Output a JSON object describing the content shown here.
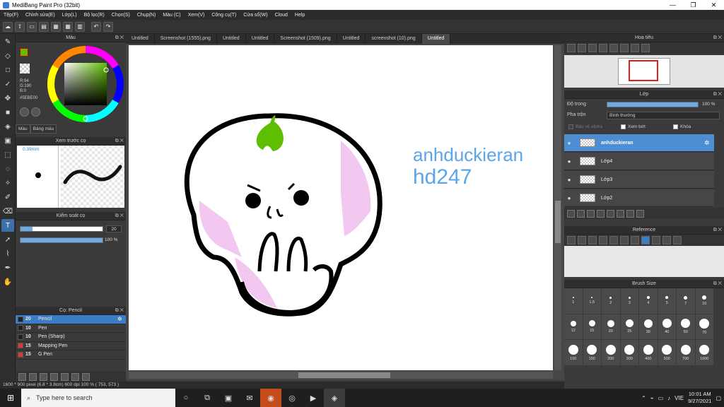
{
  "window": {
    "title": "MediBang Paint Pro (32bit)",
    "controls": [
      "—",
      "❐",
      "✕"
    ]
  },
  "menu": [
    "Tệp(F)",
    "Chỉnh sửa(E)",
    "Lớp(L)",
    "Bộ lọc(R)",
    "Chọn(S)",
    "Chụp(N)",
    "Màu (C)",
    "Xem(V)",
    "Công cụ(T)",
    "Cửa sổ(W)",
    "Cloud",
    "Help"
  ],
  "color_panel": {
    "title": "Màu",
    "r": "R:94",
    "g": "G:190",
    "b": "B:0",
    "hex": "#5EBE00",
    "fg_color": "#5EBE00",
    "tabs": [
      "Màu",
      "Bảng màu"
    ]
  },
  "brush_preview": {
    "title": "Xem trước cọ",
    "size_label": "0.39mm"
  },
  "brush_control": {
    "title": "Kiểm soát cọ",
    "size_value": "20",
    "opacity_value": "100 %",
    "size_fraction": 0.15,
    "opacity_fraction": 1.0
  },
  "brush_list": {
    "title": "Cọ: Pencil",
    "items": [
      {
        "size": "20",
        "name": "Pencil",
        "color": "#222222",
        "active": true
      },
      {
        "size": "10",
        "name": "Pen",
        "color": "#222222"
      },
      {
        "size": "10",
        "name": "Pen (Sharp)",
        "color": "#222222"
      },
      {
        "size": "15",
        "name": "Mapping Pen",
        "color": "#d23b3b"
      },
      {
        "size": "15",
        "name": "G Pen",
        "color": "#d23b3b"
      }
    ]
  },
  "doc_tabs": [
    "Untitled",
    "Screenshot (1555).png",
    "Untitled",
    "Untitled",
    "Screenshot (1509).png",
    "Untitled",
    "screenshot (10).png",
    "Untitled"
  ],
  "active_tab_index": 7,
  "canvas": {
    "text_line1": "anhduckieran",
    "text_line2": "hd247"
  },
  "status": "1600 * 900 pixel  (6.8 * 3.8cm)  600 dpi  100 %  ( 753, 573 )",
  "navigator": {
    "title": "Hoa tiêu"
  },
  "layers": {
    "title": "Lớp",
    "opacity_label": "Độ trong",
    "opacity_value": "100 %",
    "blend_label": "Pha trộn",
    "blend_value": "Bình thường",
    "protect_alpha": "Bảo vệ alpha",
    "clipping": "Xem bớt",
    "lock": "Khóa",
    "items": [
      {
        "name": "anhduckieran",
        "active": true
      },
      {
        "name": "Lớp4"
      },
      {
        "name": "Lớp3"
      },
      {
        "name": "Lớp2"
      }
    ]
  },
  "reference": {
    "title": "Reference"
  },
  "brush_size": {
    "title": "Brush Size",
    "sizes": [
      "1",
      "1.5",
      "2",
      "3",
      "4",
      "5",
      "7",
      "10",
      "12",
      "15",
      "20",
      "25",
      "30",
      "40",
      "50",
      "70",
      "100",
      "150",
      "200",
      "300",
      "400",
      "500",
      "700",
      "1000"
    ]
  },
  "taskbar": {
    "search_placeholder": "Type here to search",
    "time": "10:01 AM",
    "date": "9/27/2021",
    "lang": "VIE"
  }
}
